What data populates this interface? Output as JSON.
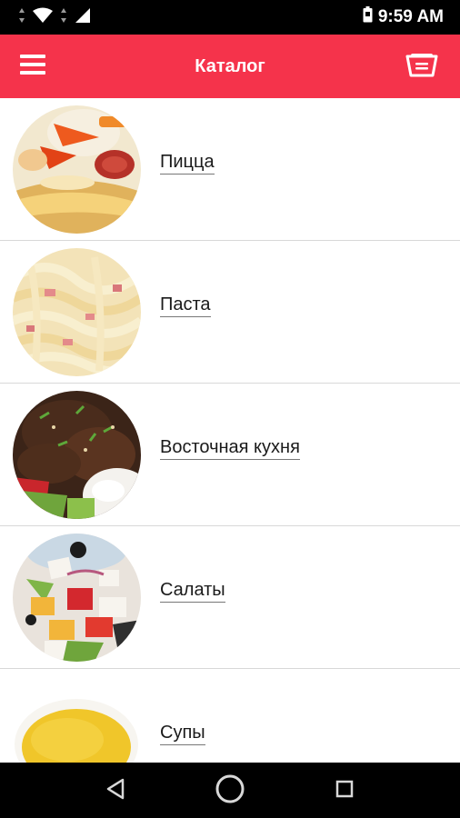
{
  "status_bar": {
    "time": "9:59 AM",
    "icons": [
      "data-arrows-icon",
      "wifi-icon",
      "data-arrows-icon",
      "signal-icon",
      "battery-icon"
    ]
  },
  "app_bar": {
    "title": "Каталог",
    "menu_icon": "menu-icon",
    "cart_icon": "basket-icon",
    "color": "#f5334b"
  },
  "catalog": {
    "items": [
      {
        "label": "Пицца",
        "image": "pizza"
      },
      {
        "label": "Паста",
        "image": "pasta"
      },
      {
        "label": "Восточная кухня",
        "image": "oriental-dish"
      },
      {
        "label": "Салаты",
        "image": "salad"
      },
      {
        "label": "Супы",
        "image": "soup"
      }
    ]
  },
  "nav_bar": {
    "icons": [
      "back-icon",
      "home-icon",
      "recents-icon"
    ]
  }
}
